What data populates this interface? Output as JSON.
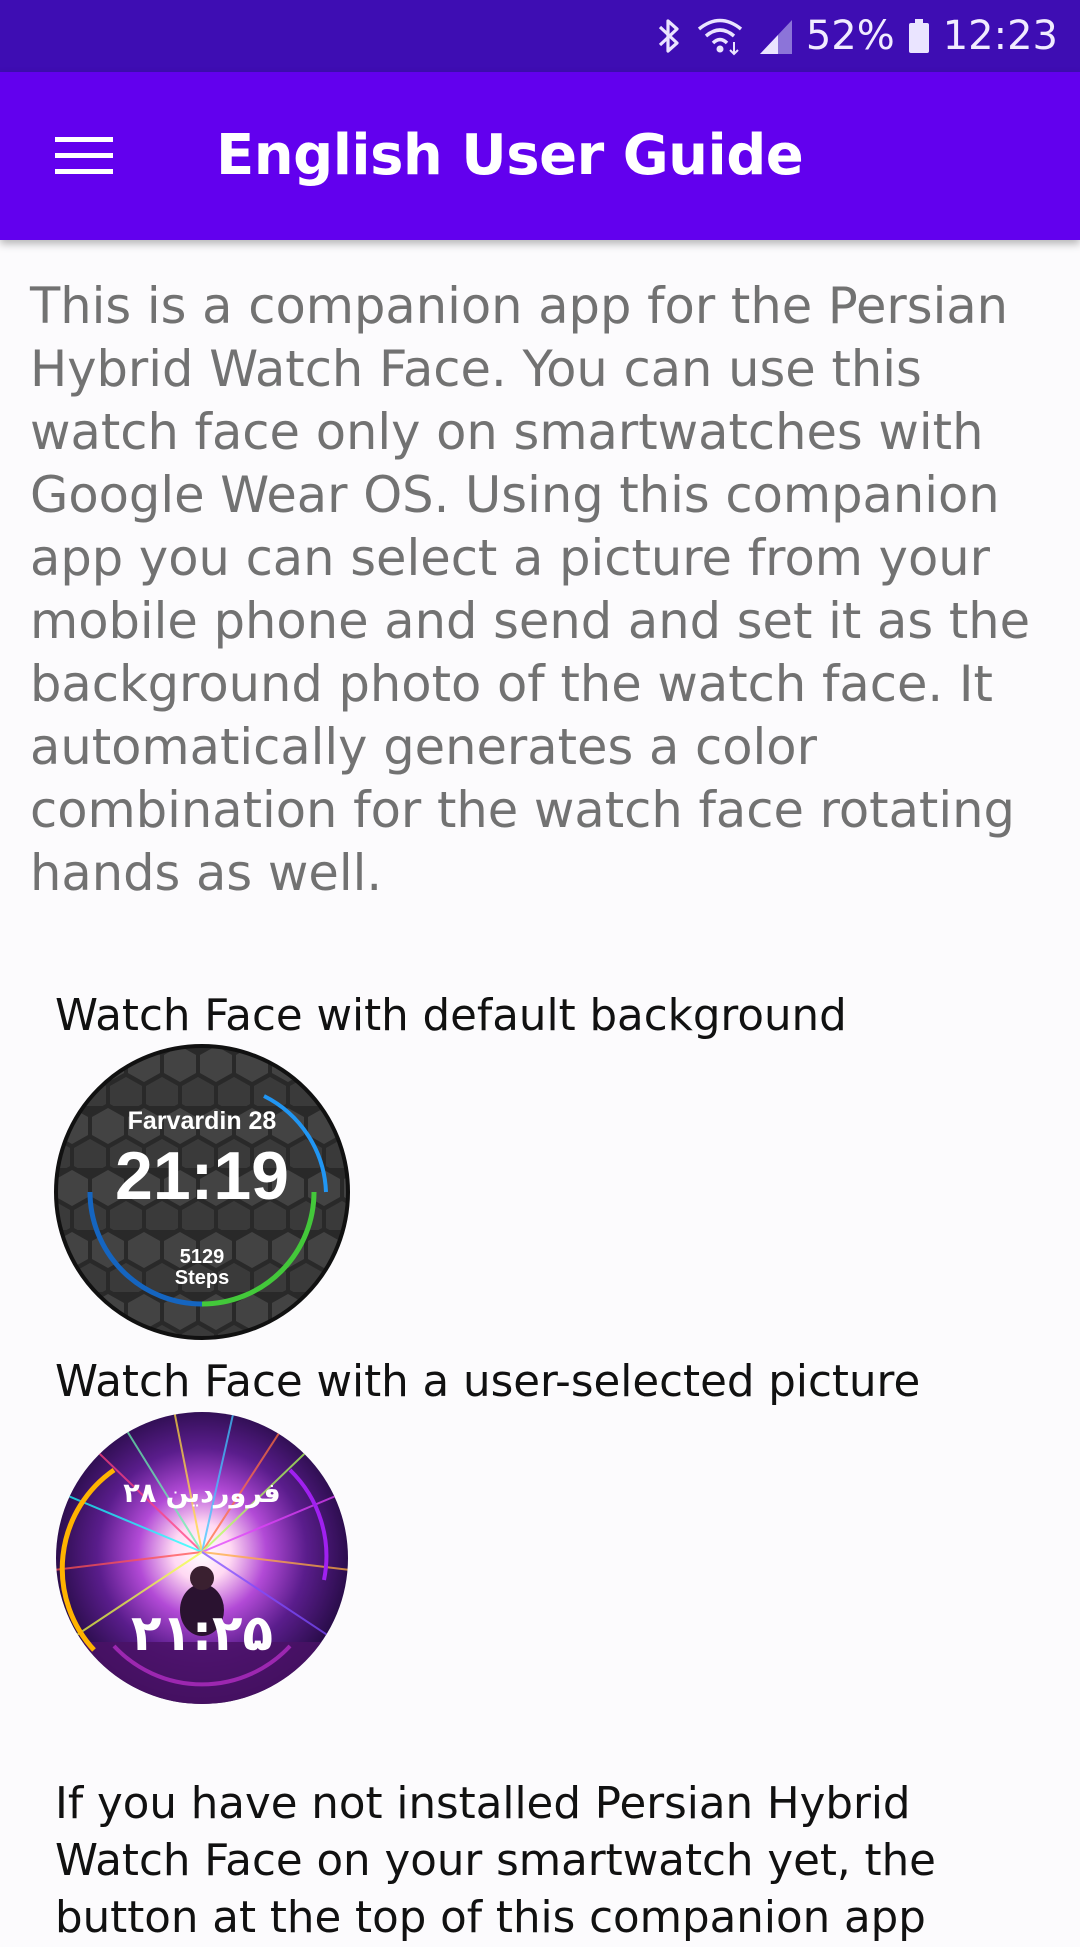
{
  "status_bar": {
    "battery_percent": "52%",
    "time": "12:23",
    "icons": [
      "bluetooth-icon",
      "wifi-icon",
      "cell-signal-icon",
      "battery-icon"
    ]
  },
  "app_bar": {
    "title": "English User Guide",
    "menu_icon": "hamburger-menu-icon",
    "background_color": "#6200ee"
  },
  "content": {
    "intro": "This is a companion app for the Persian Hybrid Watch Face. You can use this watch face only on smartwatches with Google Wear OS. Using this companion app you can select a picture from your mobile phone and send and set it as the background photo of the watch face. It automatically generates a color combination for the watch face rotating hands as well.",
    "default_caption": "Watch Face with default background",
    "default_watch": {
      "date": "Farvardin 28",
      "time": "21:19",
      "steps": "5129",
      "steps_label": "Steps"
    },
    "user_caption": "Watch Face with a user-selected picture",
    "user_watch": {
      "date": "فروردین ۲۸",
      "time": "۲۱:۲۵"
    },
    "bottom_text": "If you have not installed Persian Hybrid Watch Face on your smartwatch yet, the button at the top of this companion app"
  }
}
